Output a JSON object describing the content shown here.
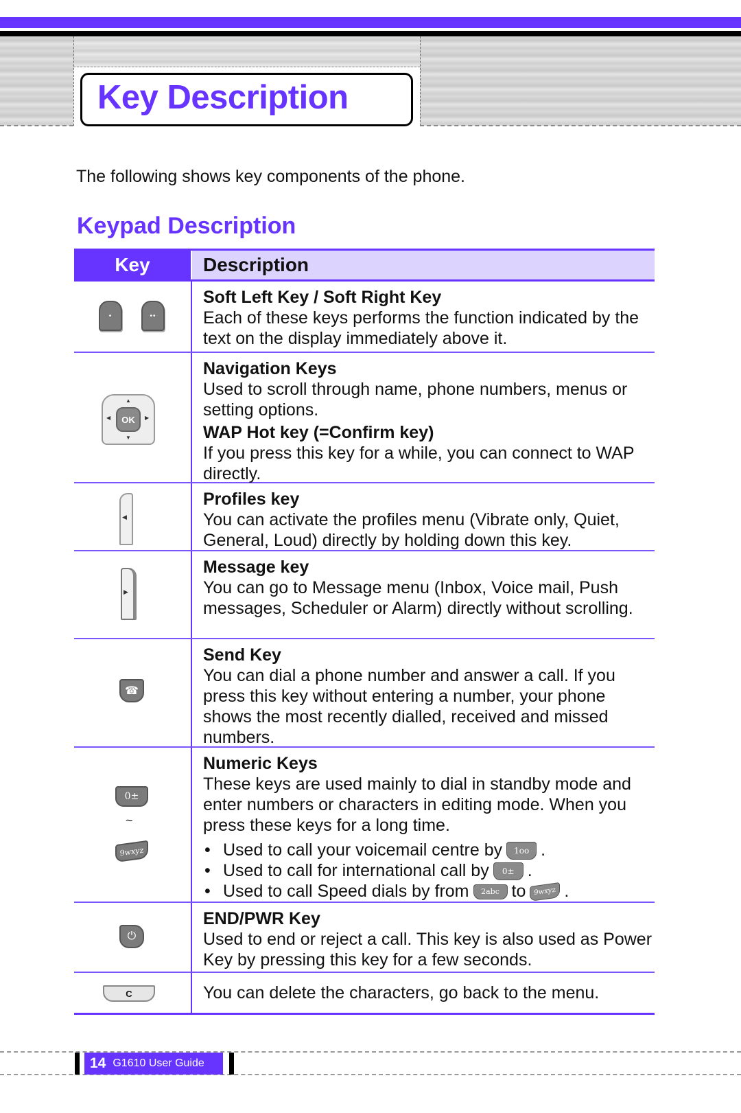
{
  "header": {
    "title": "Key Description"
  },
  "intro": "The following shows key components of the phone.",
  "section_title": "Keypad Description",
  "colors": {
    "accent": "#6633ff",
    "header_fill": "#dcd4ff"
  },
  "table": {
    "headers": {
      "key": "Key",
      "description": "Description"
    },
    "rows": [
      {
        "key_icon": "soft-left-right-keys-icon",
        "entries": [
          {
            "title": "Soft Left Key / Soft Right Key",
            "text": "Each of these keys performs the function indicated by the text on the display immediately above it."
          }
        ]
      },
      {
        "key_icon": "navigation-keys-icon",
        "ok_label": "OK",
        "entries": [
          {
            "title": "Navigation Keys",
            "text": "Used to scroll through name, phone numbers, menus or setting options."
          },
          {
            "title": "WAP Hot key (=Confirm key)",
            "text": "If you press this key for a while, you can connect to WAP directly."
          }
        ]
      },
      {
        "key_icon": "profiles-key-icon",
        "entries": [
          {
            "title": "Profiles key",
            "text": "You can activate the profiles menu (Vibrate only, Quiet, General, Loud) directly by holding down this key."
          }
        ]
      },
      {
        "key_icon": "message-key-icon",
        "entries": [
          {
            "title": "Message key",
            "text": "You can go to Message menu (Inbox, Voice mail, Push messages, Scheduler or Alarm) directly without scrolling."
          }
        ]
      },
      {
        "key_icon": "send-key-icon",
        "entries": [
          {
            "title": "Send Key",
            "text": "You can dial a phone number and answer a call. If you press this key without entering a number, your phone shows the most recently dialled, received and missed numbers."
          }
        ]
      },
      {
        "key_icon": "numeric-keys-icon",
        "icon_labels": {
          "zero": "0±",
          "range": "~",
          "nine": "9wxyz"
        },
        "entries": [
          {
            "title": "Numeric Keys",
            "text": "These keys are used mainly to dial in standby mode and enter numbers or characters in editing mode. When you press these keys for a long time."
          }
        ],
        "bullets": [
          {
            "text": "Used to call your voicemail centre by",
            "key": "1oo",
            "suffix": "."
          },
          {
            "text": "Used to call for international call by",
            "key": "0±",
            "suffix": "."
          },
          {
            "text": "Used to call Speed dials by from",
            "key": "2abc",
            "mid": "to",
            "key2": "9wxyz",
            "suffix": "."
          }
        ]
      },
      {
        "key_icon": "end-power-key-icon",
        "entries": [
          {
            "title": "END/PWR Key",
            "text": "Used to end or reject a call. This key is also used as Power Key by pressing this key for a few seconds."
          }
        ]
      },
      {
        "key_icon": "clear-key-icon",
        "clear_label": "C",
        "entries": [
          {
            "title": "",
            "text": "You can delete the characters, go back to the menu."
          }
        ]
      }
    ]
  },
  "footer": {
    "page_number": "14",
    "guide": "G1610 User Guide"
  }
}
